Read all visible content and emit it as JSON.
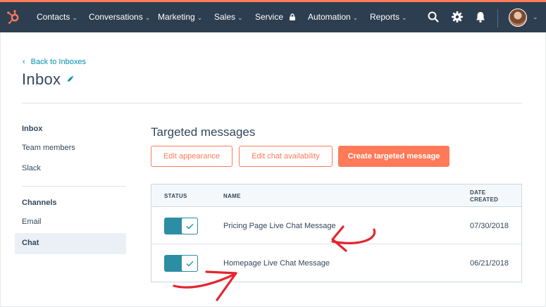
{
  "nav": {
    "items": [
      {
        "label": "Contacts",
        "caret": "⌄"
      },
      {
        "label": "Conversations",
        "caret": "⌄"
      },
      {
        "label": "Marketing",
        "caret": "⌄"
      },
      {
        "label": "Sales",
        "caret": "⌄"
      },
      {
        "label": "Service"
      },
      {
        "label": "Automation",
        "caret": "⌄"
      },
      {
        "label": "Reports",
        "caret": "⌄"
      }
    ],
    "icons": [
      "hubspot-logo-icon",
      "search-icon",
      "gear-icon",
      "bell-icon",
      "lock-icon"
    ],
    "avatar_caret": "⌄"
  },
  "header": {
    "back_chevron": "‹",
    "back_label": "Back to Inboxes",
    "title": "Inbox"
  },
  "sidebar": {
    "inbox_heading": "Inbox",
    "inbox_items": [
      "Team members",
      "Slack"
    ],
    "channels_heading": "Channels",
    "channel_items": [
      "Email",
      "Chat"
    ],
    "active_item": "Chat"
  },
  "main": {
    "title": "Targeted messages",
    "buttons": {
      "edit_appearance": "Edit appearance",
      "edit_availability": "Edit chat availability",
      "create": "Create targeted message"
    },
    "table": {
      "columns": {
        "status": "STATUS",
        "name": "NAME",
        "date_line1": "DATE",
        "date_line2": "CREATED"
      },
      "rows": [
        {
          "status_on": true,
          "name": "Pricing Page Live Chat Message",
          "date": "07/30/2018"
        },
        {
          "status_on": true,
          "name": "Homepage Live Chat Message",
          "date": "06/21/2018"
        }
      ]
    }
  },
  "colors": {
    "nav_bg": "#2d3e50",
    "accent": "#ff7a59",
    "toggle": "#2c8ea3",
    "link": "#0091ae",
    "annotation": "#e3262f"
  }
}
